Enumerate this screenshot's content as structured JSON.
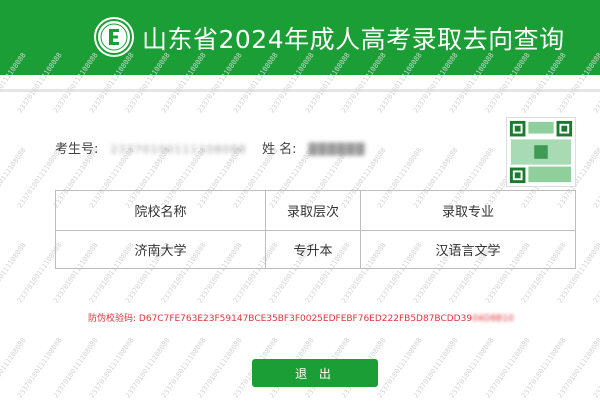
{
  "header": {
    "title": "山东省2024年成人高考录取去向查询",
    "logo_icon": "exam-authority-logo-icon"
  },
  "watermark_text": "23370100111108088",
  "student": {
    "exam_no_label": "考生号:",
    "exam_no_value": "23370100111108088",
    "name_label": "姓  名:",
    "name_value": "██████"
  },
  "table": {
    "headers": [
      "院校名称",
      "录取层次",
      "录取专业"
    ],
    "rows": [
      [
        "济南大学",
        "专升本",
        "汉语言文学"
      ]
    ]
  },
  "verify": {
    "label": "防伪校验码:",
    "code_visible": "D67C7FE763E23F59147BCE35BF3F0025EDFEBF76ED222FB5D87BCDD39",
    "code_blurred": "04D8B10"
  },
  "actions": {
    "exit_label": "退 出"
  },
  "colors": {
    "brand_green": "#1a9e35",
    "code_red": "#e0343e"
  }
}
